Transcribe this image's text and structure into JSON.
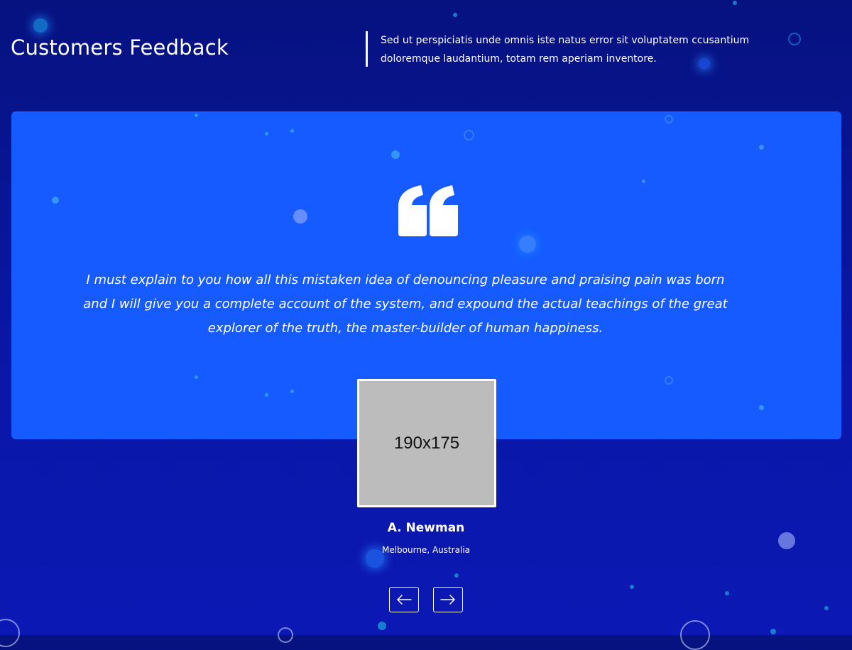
{
  "section": {
    "title": "Customers Feedback",
    "intro": "Sed ut perspiciatis unde omnis iste natus error sit voluptatem ccusantium doloremque laudantium, totam rem aperiam inventore."
  },
  "testimonial": {
    "quote_icon": "quote-icon",
    "text": "I must explain to you how all this mistaken idea of denouncing pleasure and praising pain was born and I will give you a complete account of the system, and expound the actual teachings of the great explorer of the truth, the master-builder of human happiness.",
    "avatar_placeholder": "190x175",
    "name": "A. Newman",
    "location": "Melbourne, Australia"
  },
  "navigation": {
    "prev_icon": "arrow-left-icon",
    "next_icon": "arrow-right-icon"
  },
  "colors": {
    "background": "#06127f",
    "card": "#155bff",
    "accent_dots": "#1a8fd6",
    "avatar_placeholder": "#bcbcbc"
  }
}
